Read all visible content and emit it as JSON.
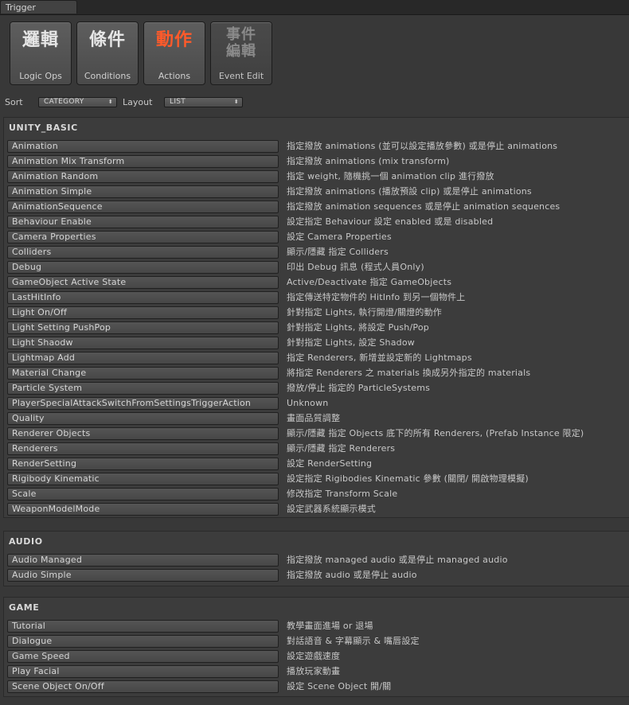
{
  "window": {
    "tab_title": "Trigger"
  },
  "toolbar": {
    "buttons": [
      {
        "glyph": "邏輯",
        "caption": "Logic Ops"
      },
      {
        "glyph": "條件",
        "caption": "Conditions"
      },
      {
        "glyph": "動作",
        "caption": "Actions"
      },
      {
        "glyph": "事件\n編輯",
        "caption": "Event Edit"
      }
    ],
    "active_index": 2,
    "active_color": "#ff5a2a"
  },
  "controls": {
    "sort_label": "Sort",
    "sort_value": "CATEGORY",
    "layout_label": "Layout",
    "layout_value": "LIST"
  },
  "sections": [
    {
      "title": "UNITY_BASIC",
      "items": [
        {
          "name": "Animation",
          "desc": "指定撥放 animations (並可以設定播放參數) 或是停止 animations"
        },
        {
          "name": "Animation Mix Transform",
          "desc": "指定撥放 animations (mix transform)"
        },
        {
          "name": "Animation Random",
          "desc": "指定 weight, 隨機挑一個 animation clip 進行撥放"
        },
        {
          "name": "Animation Simple",
          "desc": "指定撥放 animations (播放預設 clip) 或是停止 animations"
        },
        {
          "name": "AnimationSequence",
          "desc": "指定撥放 animation sequences 或是停止 animation sequences"
        },
        {
          "name": "Behaviour Enable",
          "desc": "設定指定 Behaviour 設定 enabled 或是 disabled"
        },
        {
          "name": "Camera Properties",
          "desc": "設定 Camera Properties"
        },
        {
          "name": "Colliders",
          "desc": "顯示/隱藏 指定 Colliders"
        },
        {
          "name": "Debug",
          "desc": "印出 Debug 訊息 (程式人員Only)"
        },
        {
          "name": "GameObject Active State",
          "desc": "Active/Deactivate 指定 GameObjects"
        },
        {
          "name": "LastHitInfo",
          "desc": "指定傳送特定物件的 HitInfo 到另一個物件上"
        },
        {
          "name": "Light On/Off",
          "desc": "針對指定 Lights, 執行開燈/關燈的動作"
        },
        {
          "name": "Light Setting PushPop",
          "desc": "針對指定 Lights, 將設定 Push/Pop"
        },
        {
          "name": "Light Shaodw",
          "desc": "針對指定 Lights, 設定 Shadow"
        },
        {
          "name": "Lightmap Add",
          "desc": "指定 Renderers, 新增並設定新的 Lightmaps"
        },
        {
          "name": "Material Change",
          "desc": "將指定 Renderers 之 materials 換成另外指定的 materials"
        },
        {
          "name": "Particle System",
          "desc": "撥放/停止 指定的 ParticleSystems"
        },
        {
          "name": "PlayerSpecialAttackSwitchFromSettingsTriggerAction",
          "desc": "Unknown"
        },
        {
          "name": "Quality",
          "desc": "畫面品質調整"
        },
        {
          "name": "Renderer Objects",
          "desc": "顯示/隱藏 指定 Objects 底下的所有 Renderers, (Prefab Instance 限定)"
        },
        {
          "name": "Renderers",
          "desc": "顯示/隱藏 指定 Renderers"
        },
        {
          "name": "RenderSetting",
          "desc": "設定 RenderSetting"
        },
        {
          "name": "Rigibody Kinematic",
          "desc": "設定指定 Rigibodies Kinematic 參數 (關閉/ 開啟物理模擬)"
        },
        {
          "name": "Scale",
          "desc": "修改指定 Transform Scale"
        },
        {
          "name": "WeaponModelMode",
          "desc": "設定武器系統顯示模式"
        }
      ]
    },
    {
      "title": "AUDIO",
      "items": [
        {
          "name": "Audio Managed",
          "desc": "指定撥放 managed audio 或是停止 managed audio"
        },
        {
          "name": "Audio Simple",
          "desc": "指定撥放 audio 或是停止 audio"
        }
      ]
    },
    {
      "title": "GAME",
      "items": [
        {
          "name": " Tutorial",
          "desc": "教學畫面進場 or 退場"
        },
        {
          "name": "Dialogue",
          "desc": "對話語音 & 字幕顯示 & 嘴唇設定"
        },
        {
          "name": "Game Speed",
          "desc": "設定遊戲速度"
        },
        {
          "name": "Play Facial",
          "desc": "播放玩家動畫"
        },
        {
          "name": "Scene Object On/Off",
          "desc": "設定 Scene Object 開/關"
        }
      ]
    }
  ]
}
